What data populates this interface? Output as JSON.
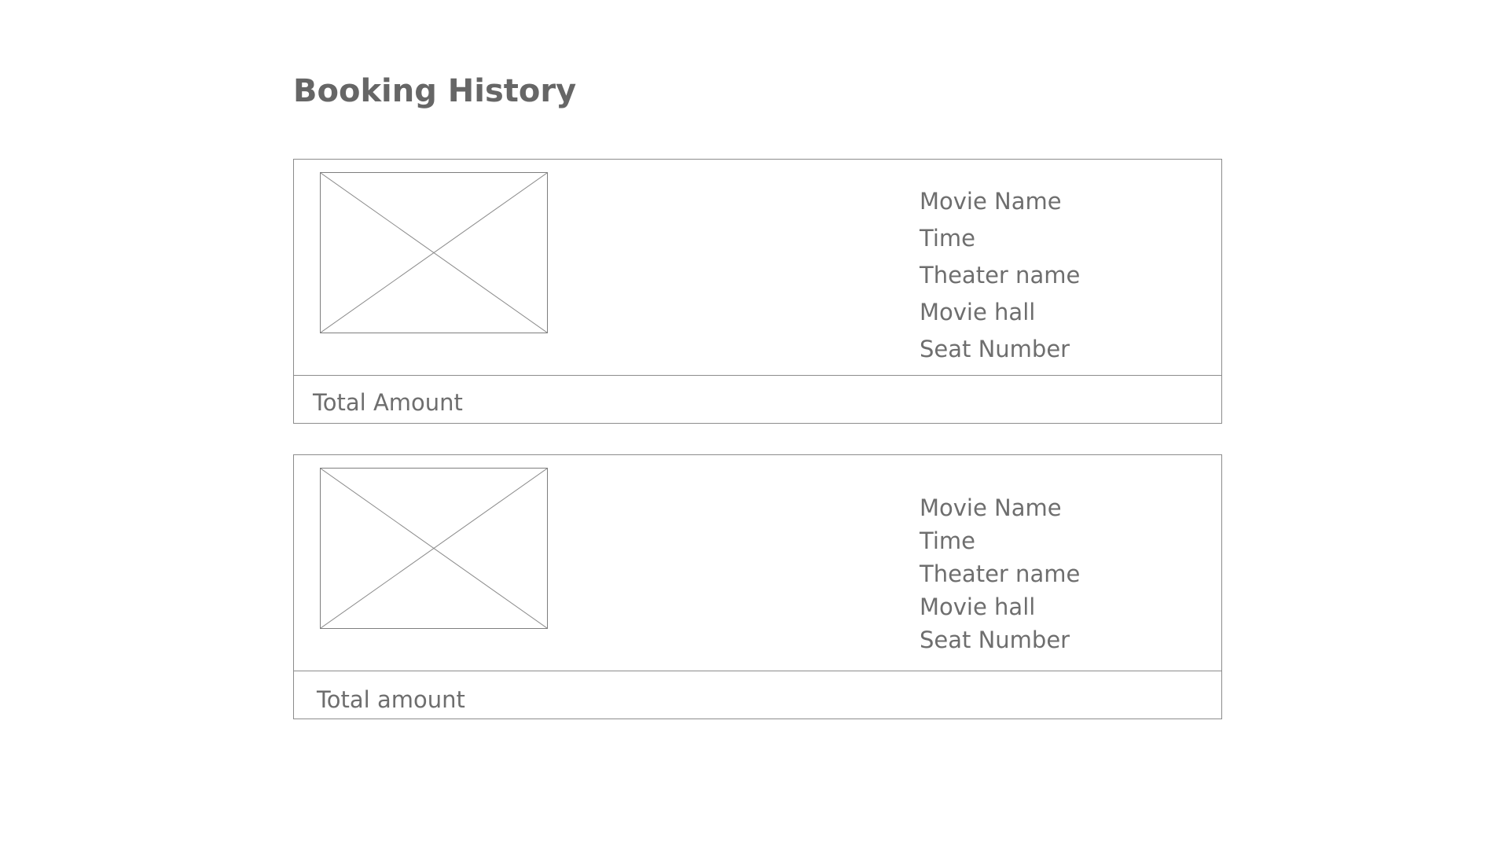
{
  "page": {
    "title": "Booking History"
  },
  "bookings": [
    {
      "poster": "image-placeholder",
      "details": [
        "Movie Name",
        "Time",
        "Theater name",
        "Movie hall",
        "Seat Number"
      ],
      "total_label": "Total Amount"
    },
    {
      "poster": "image-placeholder",
      "details": [
        "Movie Name",
        "Time",
        "Theater name",
        "Movie hall",
        "Seat Number"
      ],
      "total_label": "Total amount"
    }
  ],
  "colors": {
    "text": "#6a6a6a",
    "border": "#8c8c8c",
    "background": "#ffffff"
  }
}
